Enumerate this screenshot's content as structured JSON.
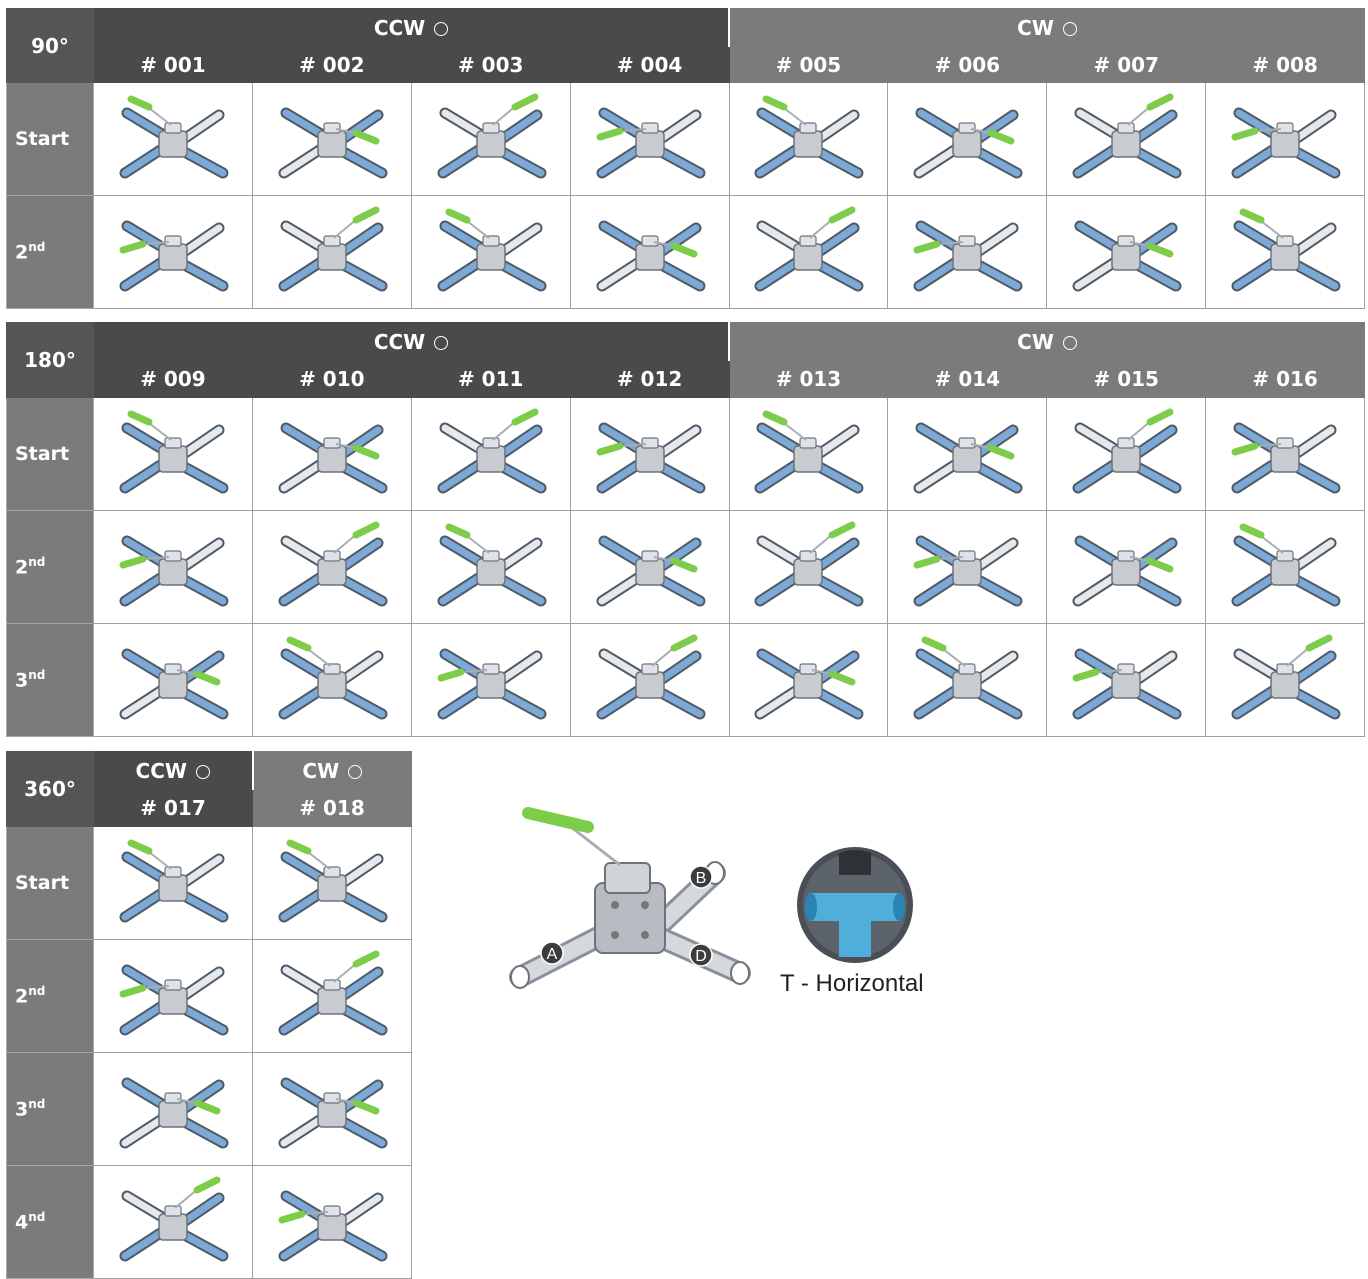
{
  "colors": {
    "handle": "#7dcc4a",
    "pipe": "#7da9d6",
    "body": "#c8ccd1",
    "ccw_header": "#4a4a4a",
    "cw_header": "#7b7b7b"
  },
  "tables": [
    {
      "angle": "90°",
      "ccw_label": "CCW",
      "cw_label": "CW",
      "numbers": [
        "# 001",
        "# 002",
        "# 003",
        "# 004",
        "# 005",
        "# 006",
        "# 007",
        "# 008"
      ],
      "rows": [
        {
          "label": "Start",
          "sup": "",
          "handles": [
            "tl",
            "r",
            "tr",
            "l",
            "tl",
            "r",
            "tr",
            "l"
          ]
        },
        {
          "label": "2",
          "sup": "nd",
          "handles": [
            "l",
            "tr",
            "tl",
            "r",
            "tr",
            "l",
            "r",
            "tl"
          ]
        }
      ]
    },
    {
      "angle": "180°",
      "ccw_label": "CCW",
      "cw_label": "CW",
      "numbers": [
        "# 009",
        "# 010",
        "# 011",
        "# 012",
        "# 013",
        "# 014",
        "# 015",
        "# 016"
      ],
      "rows": [
        {
          "label": "Start",
          "sup": "",
          "handles": [
            "tl",
            "r",
            "tr",
            "l",
            "tl",
            "r",
            "tr",
            "l"
          ]
        },
        {
          "label": "2",
          "sup": "nd",
          "handles": [
            "l",
            "tr",
            "tl",
            "r",
            "tr",
            "l",
            "r",
            "tl"
          ]
        },
        {
          "label": "3",
          "sup": "nd",
          "handles": [
            "r",
            "tl",
            "l",
            "tr",
            "r",
            "tl",
            "l",
            "tr"
          ]
        }
      ]
    },
    {
      "angle": "360°",
      "ccw_label": "CCW",
      "cw_label": "CW",
      "numbers": [
        "# 017",
        "# 018"
      ],
      "rows": [
        {
          "label": "Start",
          "sup": "",
          "handles": [
            "tl",
            "tl"
          ]
        },
        {
          "label": "2",
          "sup": "nd",
          "handles": [
            "l",
            "tr"
          ]
        },
        {
          "label": "3",
          "sup": "nd",
          "handles": [
            "r",
            "r"
          ]
        },
        {
          "label": "4",
          "sup": "nd",
          "handles": [
            "tr",
            "l"
          ]
        }
      ]
    }
  ],
  "diagram": {
    "ports": [
      "A",
      "B",
      "D"
    ],
    "caption": "T - Horizontal"
  }
}
